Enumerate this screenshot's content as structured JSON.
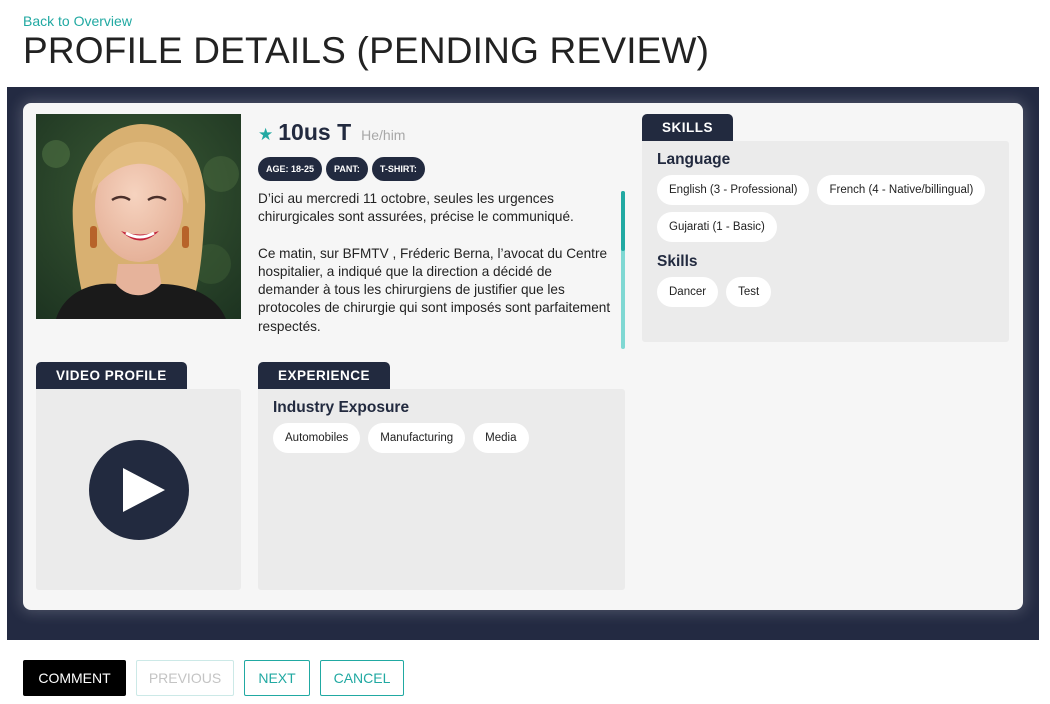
{
  "nav": {
    "back_label": "Back to Overview"
  },
  "page": {
    "title": "PROFILE DETAILS (PENDING REVIEW)"
  },
  "profile": {
    "name": "10us T",
    "pronouns": "He/him",
    "badges": [
      "AGE: 18-25",
      "PANT:",
      "T-SHIRT:"
    ],
    "bio": [
      "D’ici au mercredi 11 octobre, seules les urgences chirurgicales sont assurées, précise le communiqué.",
      "Ce matin, sur BFMTV , Fréderic Berna, l’avocat du Centre hospitalier, a indiqué que la direction  a décidé de demander à tous les chirurgiens de justifier que les protocoles de chirurgie qui sont imposés sont parfaitement respectés."
    ]
  },
  "video": {
    "tab_label": "VIDEO PROFILE"
  },
  "experience": {
    "tab_label": "EXPERIENCE",
    "heading": "Industry Exposure",
    "items": [
      "Automobiles",
      "Manufacturing",
      "Media"
    ]
  },
  "skills": {
    "tab_label": "SKILLS",
    "language_heading": "Language",
    "languages": [
      "English (3 - Professional)",
      "French (4 - Native/billingual)",
      "Gujarati (1 - Basic)"
    ],
    "skills_heading": "Skills",
    "skills": [
      "Dancer",
      "Test"
    ]
  },
  "actions": {
    "comment": "COMMENT",
    "previous": "PREVIOUS",
    "next": "NEXT",
    "cancel": "CANCEL"
  },
  "colors": {
    "accent": "#21a9a2",
    "navy": "#222a3f",
    "frame": "#232a42"
  },
  "icons": [
    "star-icon",
    "play-icon"
  ]
}
